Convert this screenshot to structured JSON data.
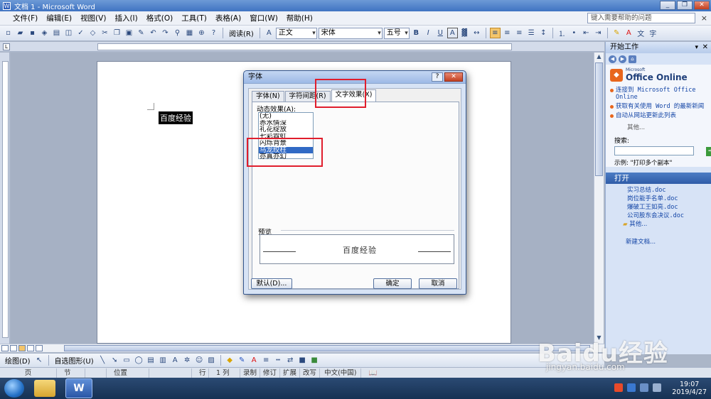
{
  "window": {
    "title": "文档 1 - Microsoft Word",
    "buttons": [
      "_",
      "❐",
      "✕"
    ]
  },
  "menubar": {
    "items": [
      "文件(F)",
      "编辑(E)",
      "视图(V)",
      "插入(I)",
      "格式(O)",
      "工具(T)",
      "表格(A)",
      "窗口(W)",
      "帮助(H)"
    ],
    "help_placeholder": "键入需要帮助的问题",
    "close_glyph": "×"
  },
  "toolbar": {
    "read_label": "阅读(R)",
    "style_value": "正文",
    "font_value": "宋体",
    "size_value": "五号",
    "bold": "B",
    "italic": "I",
    "underline": "U",
    "char_border": "A"
  },
  "document": {
    "text": "百度经验"
  },
  "dialog": {
    "title": "字体",
    "help": "?",
    "close": "✕",
    "tabs": [
      "字体(N)",
      "字符间距(R)",
      "文字效果(X)"
    ],
    "active_tab": 2,
    "effects_label": "动态效果(A):",
    "effects": [
      "(无)",
      "赤水情深",
      "礼花绽放",
      "七彩霓虹",
      "闪烁背景",
      "乌龙绞柱",
      "亦真亦幻"
    ],
    "selected_effect": 5,
    "preview_label": "预览",
    "preview_text": "百度经验",
    "default_button": "默认(D)...",
    "ok_button": "确定",
    "cancel_button": "取消"
  },
  "taskpane": {
    "title": "开始工作",
    "logo_small": "Microsoft",
    "logo_text": "Office Online",
    "links": [
      "连接到 Microsoft Office Online",
      "获取有关使用 Word 的最新新闻",
      "自动从网站更新此列表"
    ],
    "more": "其他...",
    "search_label": "搜索:",
    "example": "示例: \"打印多个副本\"",
    "open_title": "打开",
    "files": [
      "实习总结.doc",
      "岗位能手名单.doc",
      "爆破工王如亮.doc",
      "公司股东会决议.doc"
    ],
    "files_more": "其他...",
    "new_doc": "新建文档..."
  },
  "drawbar": {
    "draw_label": "绘图(D)",
    "autoshape_label": "自选图形(U)"
  },
  "statusbar": {
    "cells": [
      "页",
      "节",
      "",
      "位置",
      "",
      "行",
      "1 列",
      "录制",
      "修订",
      "扩展",
      "改写",
      "中文(中国)"
    ]
  },
  "taskbar": {
    "time": "19:07",
    "date": "2019/4/27"
  },
  "watermark": {
    "text": "Baidu经验",
    "sub": "jingyan.baidu.com"
  },
  "colors": {
    "highlight": "#316ac5",
    "annotation": "#e01e2d",
    "title_bar": "#3f73c2"
  }
}
